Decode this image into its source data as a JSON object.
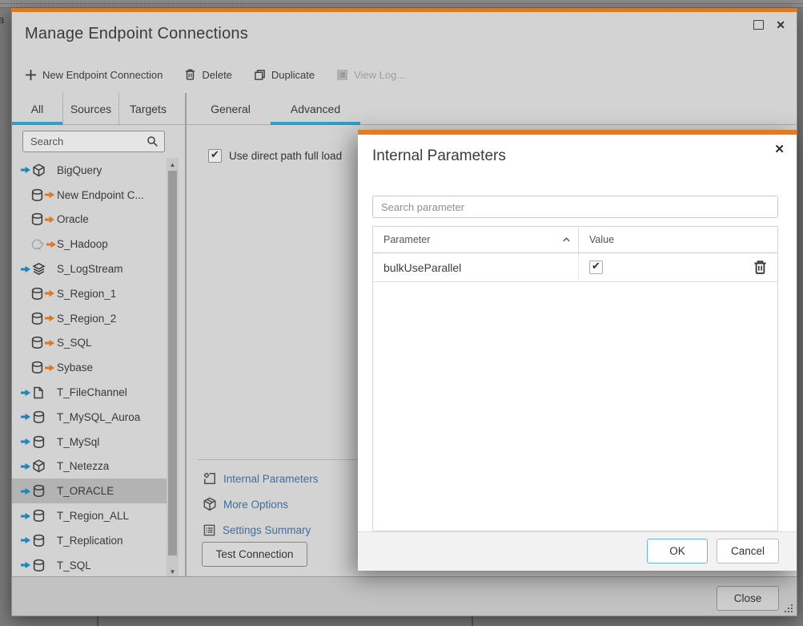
{
  "backdrop": {
    "stray_text": "a"
  },
  "window": {
    "title": "Manage Endpoint Connections",
    "close_glyph": "✕"
  },
  "toolbar": {
    "new_endpoint_label": "New Endpoint Connection",
    "delete_label": "Delete",
    "duplicate_label": "Duplicate",
    "view_log_label": "View Log..."
  },
  "sidebar": {
    "tabs": [
      {
        "label": "All",
        "active": true
      },
      {
        "label": "Sources",
        "active": false
      },
      {
        "label": "Targets",
        "active": false
      }
    ],
    "search_placeholder": "Search",
    "endpoints": [
      {
        "label": "BigQuery",
        "type": "target",
        "icon": "cube"
      },
      {
        "label": "New Endpoint C...",
        "type": "source",
        "icon": "db"
      },
      {
        "label": "Oracle",
        "type": "source",
        "icon": "db"
      },
      {
        "label": "S_Hadoop",
        "type": "source",
        "icon": "hadoop"
      },
      {
        "label": "S_LogStream",
        "type": "target",
        "icon": "stack"
      },
      {
        "label": "S_Region_1",
        "type": "source",
        "icon": "db"
      },
      {
        "label": "S_Region_2",
        "type": "source",
        "icon": "db"
      },
      {
        "label": "S_SQL",
        "type": "source",
        "icon": "db"
      },
      {
        "label": "Sybase",
        "type": "source",
        "icon": "db"
      },
      {
        "label": "T_FileChannel",
        "type": "target",
        "icon": "file"
      },
      {
        "label": "T_MySQL_Auroa",
        "type": "target",
        "icon": "db"
      },
      {
        "label": "T_MySql",
        "type": "target",
        "icon": "db"
      },
      {
        "label": "T_Netezza",
        "type": "target",
        "icon": "cube"
      },
      {
        "label": "T_ORACLE",
        "type": "target",
        "icon": "db",
        "selected": true
      },
      {
        "label": "T_Region_ALL",
        "type": "target",
        "icon": "db"
      },
      {
        "label": "T_Replication",
        "type": "target",
        "icon": "db"
      },
      {
        "label": "T_SQL",
        "type": "target",
        "icon": "db"
      }
    ]
  },
  "panel": {
    "tabs": [
      {
        "label": "General",
        "active": false
      },
      {
        "label": "Advanced",
        "active": true
      }
    ],
    "direct_path_checkbox": {
      "label": "Use direct path full load",
      "checked": true
    },
    "links": [
      {
        "label": "Internal Parameters",
        "icon": "gearBracket"
      },
      {
        "label": "More Options",
        "icon": "box"
      },
      {
        "label": "Settings Summary",
        "icon": "summary"
      }
    ],
    "test_connection_label": "Test Connection"
  },
  "footer": {
    "close_label": "Close"
  },
  "modal": {
    "title": "Internal Parameters",
    "close_glyph": "✕",
    "search_placeholder": "Search parameter",
    "table": {
      "columns": [
        "Parameter",
        "Value"
      ],
      "sort": {
        "column": "Parameter",
        "direction": "asc"
      },
      "rows": [
        {
          "parameter": "bulkUseParallel",
          "value_checked": true
        }
      ]
    },
    "ok_label": "OK",
    "cancel_label": "Cancel"
  },
  "colors": {
    "accent_orange_dimmed": "#d9792a",
    "accent_orange": "#e8791d",
    "accent_blue": "#2e9fc7",
    "link_blue": "#3d6f9f",
    "source_arrow_orange": "#d97827",
    "target_arrow_blue": "#1d86bf"
  }
}
